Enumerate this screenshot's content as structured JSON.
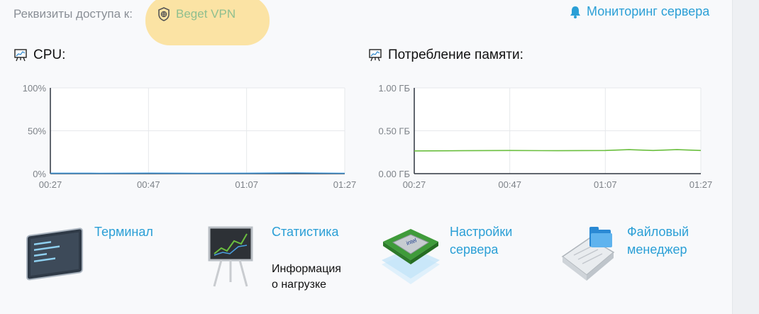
{
  "header": {
    "access_label": "Реквизиты доступа к:",
    "vpn_label": "Beget VPN",
    "monitor_label": "Мониторинг сервера"
  },
  "charts": {
    "cpu_title": "CPU:",
    "memory_title": "Потребление памяти:"
  },
  "chart_data": [
    {
      "type": "line",
      "title": "CPU:",
      "x_ticks": [
        "00:27",
        "00:47",
        "01:07",
        "01:27"
      ],
      "y_ticks": [
        "100%",
        "50%",
        "0%"
      ],
      "ylim": [
        0,
        100
      ],
      "grid": true,
      "series": [
        {
          "color": "#3a8fd0",
          "x": [
            0,
            10,
            20,
            30,
            40,
            50,
            60
          ],
          "values": [
            0.5,
            0.4,
            0.6,
            0.4,
            0.5,
            0.8,
            0.4
          ]
        }
      ]
    },
    {
      "type": "line",
      "title": "Потребление памяти:",
      "x_ticks": [
        "00:27",
        "00:47",
        "01:07",
        "01:27"
      ],
      "y_ticks": [
        "1.00 ГБ",
        "0.50 ГБ",
        "0.00 ГБ"
      ],
      "ylim": [
        0,
        1
      ],
      "grid": true,
      "series": [
        {
          "color": "#6bbf3f",
          "x": [
            0,
            10,
            20,
            30,
            40,
            45,
            50,
            55,
            60
          ],
          "values": [
            0.265,
            0.268,
            0.27,
            0.268,
            0.27,
            0.28,
            0.27,
            0.28,
            0.27
          ]
        }
      ]
    }
  ],
  "tools": {
    "terminal_label": "Терминал",
    "stats_label": "Статистика",
    "stats_desc_line1": "Информация",
    "stats_desc_line2": "о нагрузке",
    "settings_label_line1": "Настройки",
    "settings_label_line2": "сервера",
    "files_label_line1": "Файловый",
    "files_label_line2": "менеджер"
  },
  "icons": {
    "vpn": "shield-globe-icon",
    "monitor": "bell-icon",
    "chart": "presentation-chart-icon"
  }
}
